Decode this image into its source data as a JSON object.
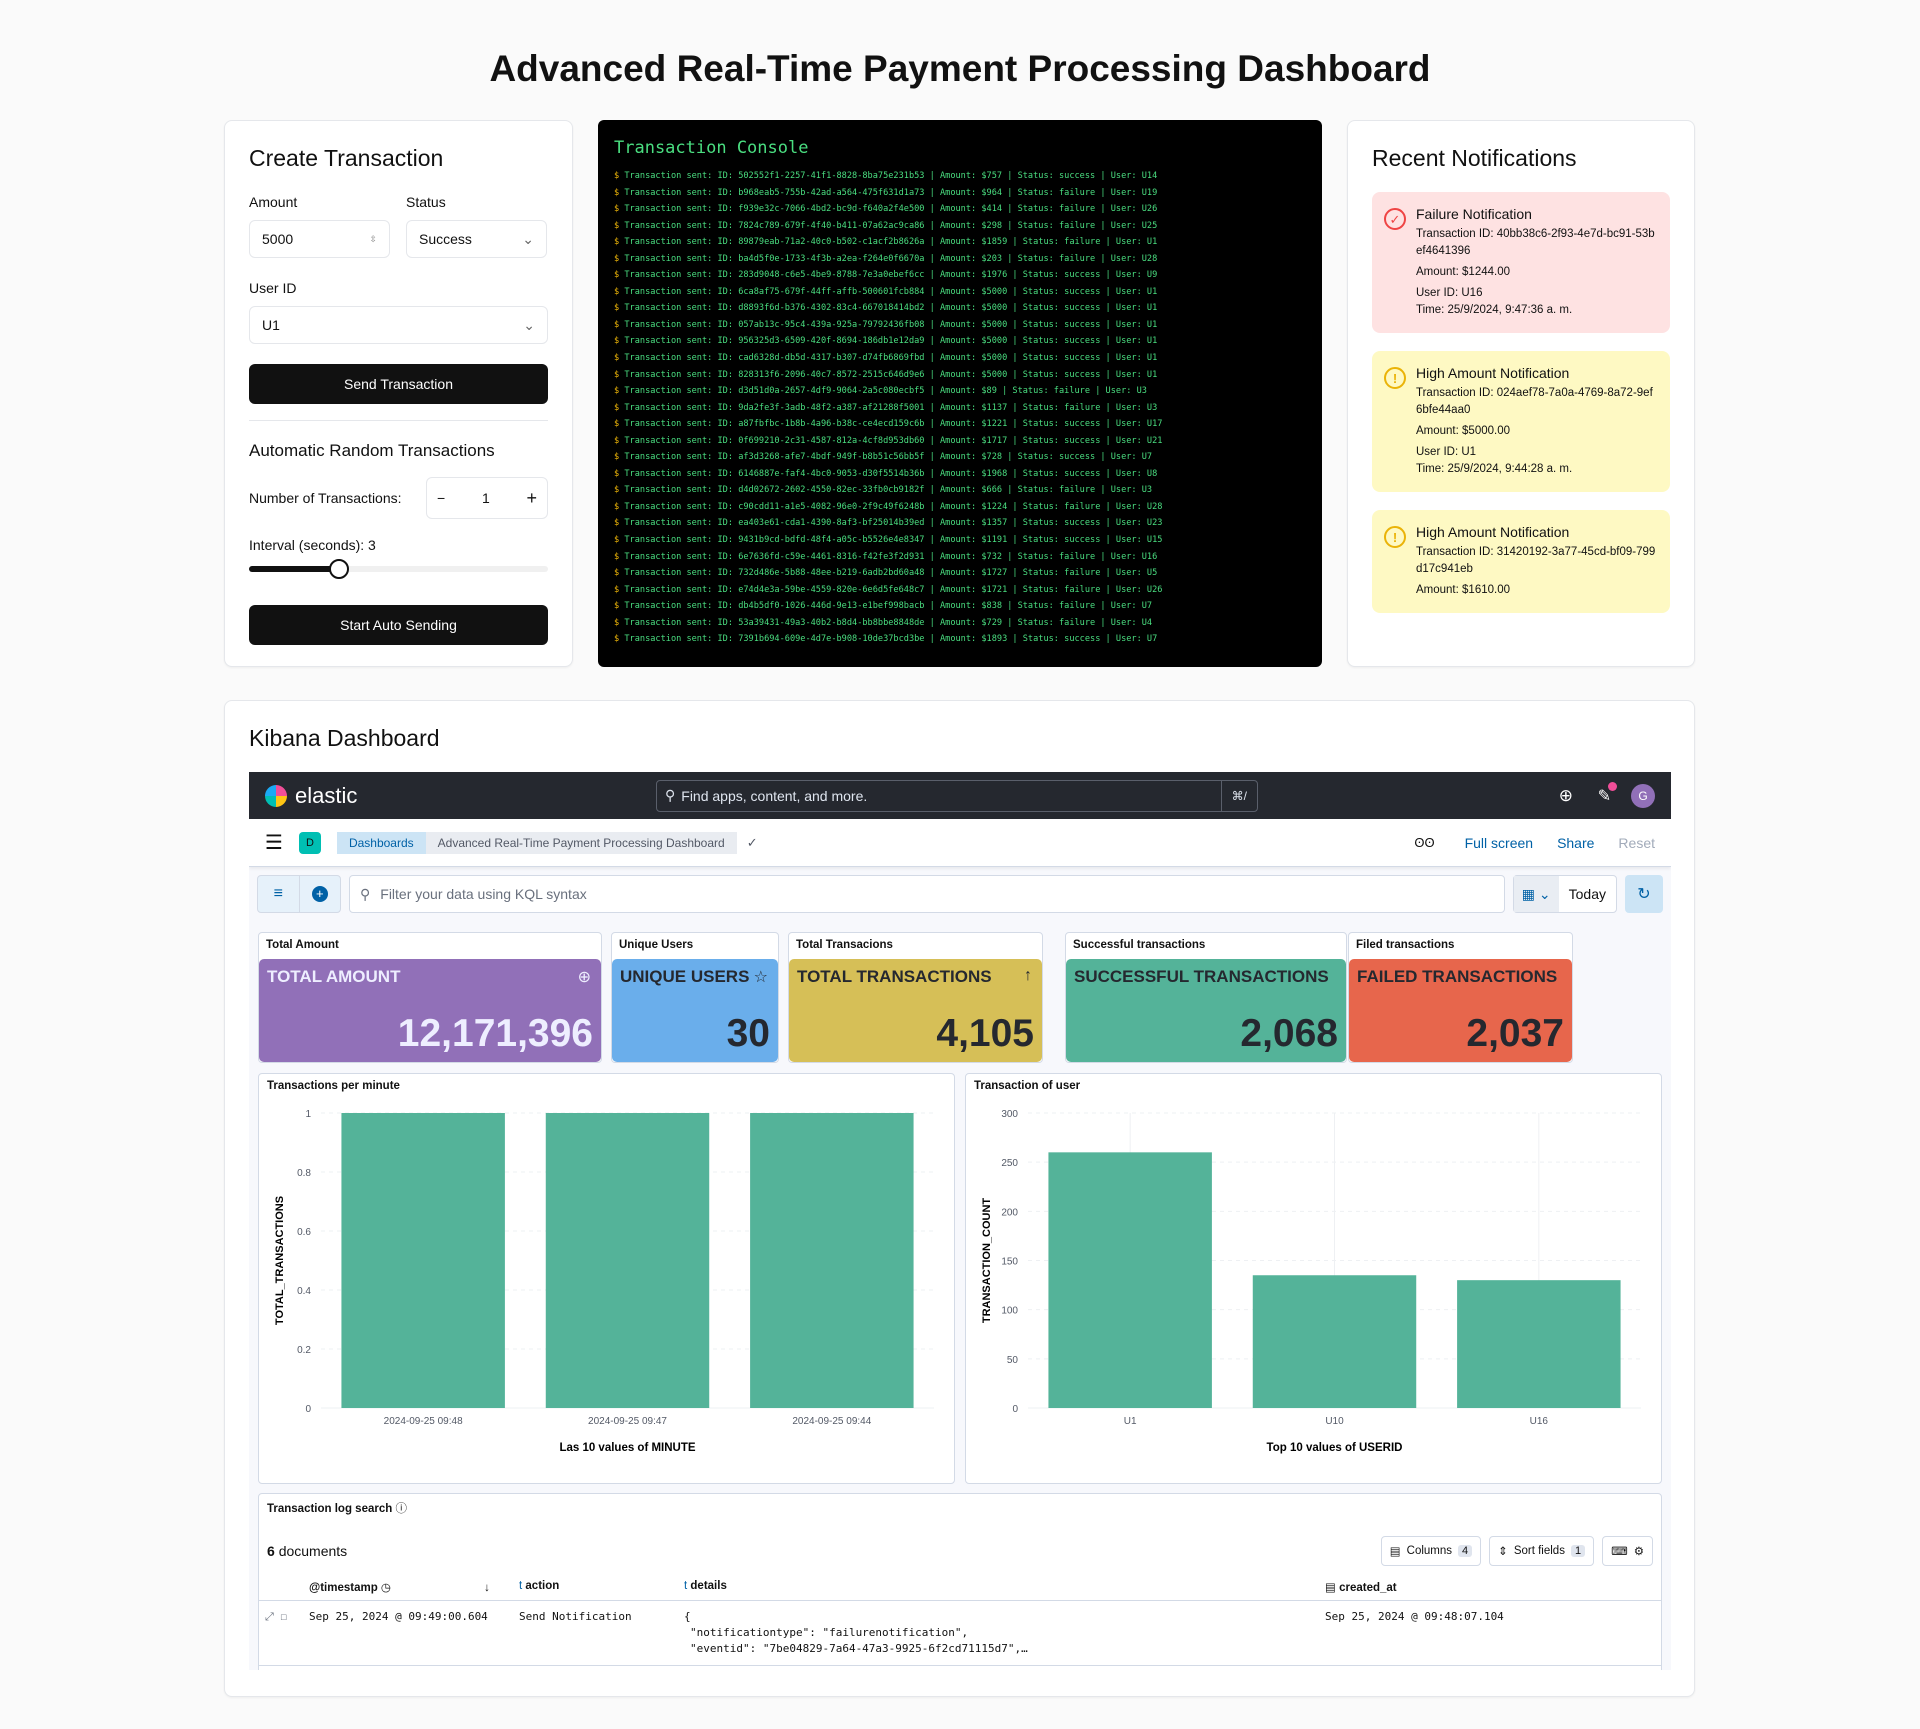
{
  "page_title": "Advanced Real-Time Payment Processing Dashboard",
  "create": {
    "title": "Create Transaction",
    "amount_label": "Amount",
    "amount_value": "5000",
    "status_label": "Status",
    "status_value": "Success",
    "user_label": "User ID",
    "user_value": "U1",
    "send_label": "Send Transaction",
    "auto_title": "Automatic Random Transactions",
    "num_label": "Number of Transactions:",
    "num_value": "1",
    "interval_label": "Interval (seconds): 3",
    "interval_value": 3,
    "interval_max": 10,
    "start_label": "Start Auto Sending"
  },
  "console": {
    "title": "Transaction Console",
    "prompt": "$",
    "lines": [
      "Transaction sent: ID: 502552f1-2257-41f1-8828-8ba75e231b53 | Amount: $757 | Status: success | User: U14",
      "Transaction sent: ID: b968eab5-755b-42ad-a564-475f631d1a73 | Amount: $964 | Status: failure | User: U19",
      "Transaction sent: ID: f939e32c-7066-4bd2-bc9d-f640a2f4e500 | Amount: $414 | Status: failure | User: U26",
      "Transaction sent: ID: 7824c789-679f-4f40-b411-07a62ac9ca86 | Amount: $298 | Status: failure | User: U25",
      "Transaction sent: ID: 89879eab-71a2-40c0-b502-c1acf2b8626a | Amount: $1859 | Status: failure | User: U1",
      "Transaction sent: ID: ba4d5f0e-1733-4f3b-a2ea-f264e0f6670a | Amount: $203 | Status: failure | User: U28",
      "Transaction sent: ID: 283d9048-c6e5-4be9-8788-7e3a0ebef6cc | Amount: $1976 | Status: success | User: U9",
      "Transaction sent: ID: 6ca8af75-679f-44ff-affb-500601fcb884 | Amount: $5000 | Status: success | User: U1",
      "Transaction sent: ID: d8893f6d-b376-4302-83c4-667018414bd2 | Amount: $5000 | Status: success | User: U1",
      "Transaction sent: ID: 057ab13c-95c4-439a-925a-79792436fb08 | Amount: $5000 | Status: success | User: U1",
      "Transaction sent: ID: 956325d3-6509-420f-8694-186db1e12da9 | Amount: $5000 | Status: success | User: U1",
      "Transaction sent: ID: cad6328d-db5d-4317-b307-d74fb6869fbd | Amount: $5000 | Status: success | User: U1",
      "Transaction sent: ID: 828313f6-2096-40c7-8572-2515c646d9e6 | Amount: $5000 | Status: success | User: U1",
      "Transaction sent: ID: d3d51d0a-2657-4df9-9064-2a5c080ecbf5 | Amount: $89 | Status: failure | User: U3",
      "Transaction sent: ID: 9da2fe3f-3adb-48f2-a387-af21288f5001 | Amount: $1137 | Status: failure | User: U3",
      "Transaction sent: ID: a87fbfbc-1b8b-4a96-b38c-ce4ecd159c6b | Amount: $1221 | Status: success | User: U17",
      "Transaction sent: ID: 0f699210-2c31-4587-812a-4cf8d953db60 | Amount: $1717 | Status: success | User: U21",
      "Transaction sent: ID: af3d3268-afe7-4bdf-949f-b8b51c56bb5f | Amount: $728 | Status: success | User: U7",
      "Transaction sent: ID: 6146887e-faf4-4bc0-9053-d30f5514b36b | Amount: $1968 | Status: success | User: U8",
      "Transaction sent: ID: d4d02672-2602-4550-82ec-33fb0cb9182f | Amount: $666 | Status: failure | User: U3",
      "Transaction sent: ID: c90cdd11-a1e5-4082-96e0-2f9c49f6248b | Amount: $1224 | Status: failure | User: U28",
      "Transaction sent: ID: ea403e61-cda1-4390-8af3-bf25014b39ed | Amount: $1357 | Status: success | User: U23",
      "Transaction sent: ID: 9431b9cd-bdfd-48f4-a05c-b5526e4e8347 | Amount: $1191 | Status: success | User: U15",
      "Transaction sent: ID: 6e7636fd-c59e-4461-8316-f42fe3f2d931 | Amount: $732 | Status: failure | User: U16",
      "Transaction sent: ID: 732d486e-5b88-48ee-b219-6adb2bd60a48 | Amount: $1727 | Status: failure | User: U5",
      "Transaction sent: ID: e74d4e3a-59be-4559-820e-6e6d5fe648c7 | Amount: $1721 | Status: failure | User: U26",
      "Transaction sent: ID: db4b5df0-1026-446d-9e13-e1bef998bacb | Amount: $838 | Status: failure | User: U7",
      "Transaction sent: ID: 53a39431-49a3-40b2-b8d4-bb8bbe8848de | Amount: $729 | Status: failure | User: U4",
      "Transaction sent: ID: 7391b694-609e-4d7e-b908-10de37bcd3be | Amount: $1893 | Status: success | User: U7"
    ]
  },
  "notifications": {
    "title": "Recent Notifications",
    "items": [
      {
        "type": "failure",
        "icon": "check-circle-icon",
        "title": "Failure Notification",
        "tx": "Transaction ID: 40bb38c6-2f93-4e7d-bc91-53bef4641396",
        "amount": "Amount: $1244.00",
        "user": "User ID: U16",
        "time": "Time: 25/9/2024, 9:47:36 a. m."
      },
      {
        "type": "high",
        "icon": "warning-circle-icon",
        "title": "High Amount Notification",
        "tx": "Transaction ID: 024aef78-7a0a-4769-8a72-9ef6bfe44aa0",
        "amount": "Amount: $5000.00",
        "user": "User ID: U1",
        "time": "Time: 25/9/2024, 9:44:28 a. m."
      },
      {
        "type": "high",
        "icon": "warning-circle-icon",
        "title": "High Amount Notification",
        "tx": "Transaction ID: 31420192-3a77-45cd-bf09-799d17c941eb",
        "amount": "Amount: $1610.00"
      }
    ]
  },
  "kibana": {
    "title": "Kibana Dashboard",
    "brand": "elastic",
    "search_placeholder": "Find apps, content, and more.",
    "shortcut": "⌘/",
    "avatar": "G",
    "space": "D",
    "breadcrumbs": [
      "Dashboards",
      "Advanced Real-Time Payment Processing Dashboard"
    ],
    "actions": {
      "full_screen": "Full screen",
      "share": "Share",
      "reset": "Reset"
    },
    "kql_placeholder": "Filter your data using KQL syntax",
    "time": "Today",
    "metrics": [
      {
        "header": "Total Amount",
        "title": "TOTAL AMOUNT",
        "value": "12,171,396",
        "color": "#9170b8",
        "text": "#eef",
        "icon": "globe-icon"
      },
      {
        "header": "Unique Users",
        "title": "UNIQUE USERS",
        "value": "30",
        "color": "#6aaeeb",
        "text": "#25282f",
        "icon": "star-icon"
      },
      {
        "header": "Total Transacions",
        "title": "TOTAL TRANSACTIONS",
        "value": "4,105",
        "color": "#d6bf57",
        "text": "#25282f",
        "icon": "arrow-up-icon"
      },
      {
        "header": "Successful transactions",
        "title": "SUCCESSFUL TRANSACTIONS",
        "value": "2,068",
        "color": "#54b399",
        "text": "#25282f",
        "icon": ""
      },
      {
        "header": "Filed transactions",
        "title": "FAILED TRANSACTIONS",
        "value": "2,037",
        "color": "#e7664c",
        "text": "#25282f",
        "icon": ""
      }
    ],
    "log": {
      "title": "Transaction log search",
      "count": "6",
      "count_label": "documents",
      "columns_label": "Columns",
      "columns_count": "4",
      "sort_label": "Sort fields",
      "sort_count": "1",
      "headers": [
        "@timestamp",
        "action",
        "details",
        "created_at"
      ],
      "rows": [
        {
          "timestamp": "Sep 25, 2024 @ 09:49:00.604",
          "action": "Send Notification",
          "details": [
            "{",
            "\"notificationtype\": \"failurenotification\",",
            "\"eventid\": \"7be04829-7a64-47a3-9925-6f2cd71115d7\",…"
          ],
          "created_at": "Sep 25, 2024 @ 09:48:07.104"
        }
      ]
    }
  },
  "chart_data": [
    {
      "type": "bar",
      "title": "Transactions per minute",
      "xlabel": "Las 10 values of MINUTE",
      "ylabel": "TOTAL_TRANSACTIONS",
      "categories": [
        "2024-09-25 09:48",
        "2024-09-25 09:47",
        "2024-09-25 09:44"
      ],
      "values": [
        1,
        1,
        1
      ],
      "ylim": [
        0,
        1
      ],
      "yticks": [
        0,
        0.2,
        0.4,
        0.6,
        0.8,
        1
      ],
      "color": "#54b399",
      "grid": true
    },
    {
      "type": "bar",
      "title": "Transaction of user",
      "xlabel": "Top 10 values of USERID",
      "ylabel": "TRANSACTION_COUNT",
      "categories": [
        "U1",
        "U10",
        "U16"
      ],
      "values": [
        260,
        135,
        130
      ],
      "ylim": [
        0,
        300
      ],
      "yticks": [
        0,
        50,
        100,
        150,
        200,
        250,
        300
      ],
      "color": "#54b399",
      "grid": true
    }
  ]
}
